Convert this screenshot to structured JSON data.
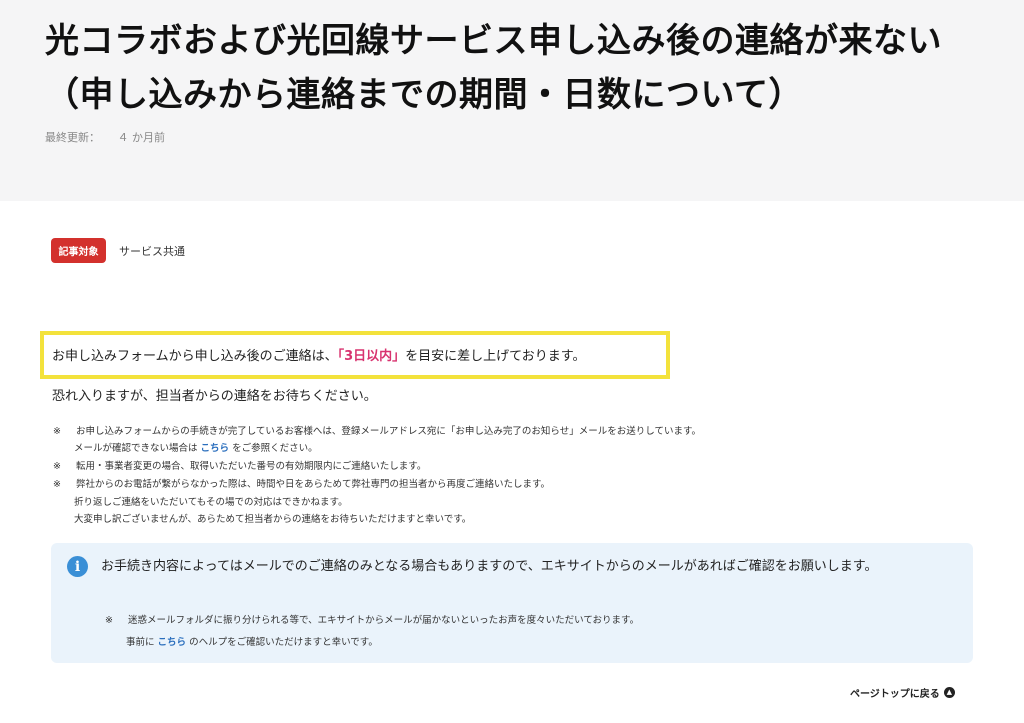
{
  "header": {
    "title": "光コラボおよび光回線サービス申し込み後の連絡が来ない（申し込みから連絡までの期間・日数について）",
    "updated_label": "最終更新：",
    "updated_value": "４ か月前"
  },
  "target": {
    "badge": "記事対象",
    "text": "サービス共通"
  },
  "lead": {
    "before": "お申し込みフォームから申し込み後のご連絡は、",
    "strong": "「3日以内」",
    "after": "を目安に差し上げております。",
    "line2": "恐れ入りますが、担当者からの連絡をお待ちください。"
  },
  "notes": {
    "mark": "※",
    "n1_line1": "お申し込みフォームからの手続きが完了しているお客様へは、登録メールアドレス宛に「お申し込み完了のお知らせ」メールをお送りしています。",
    "n1_line2_before": "メールが確認できない場合は",
    "n1_link": "こちら",
    "n1_line2_after": "をご参照ください。",
    "n2": "転用・事業者変更の場合、取得いただいた番号の有効期限内にご連絡いたします。",
    "n3_line1": "弊社からのお電話が繋がらなかった際は、時間や日をあらためて弊社専門の担当者から再度ご連絡いたします。",
    "n3_line2": "折り返しご連絡をいただいてもその場での対応はできかねます。",
    "n3_line3": "大変申し訳ございませんが、あらためて担当者からの連絡をお待ちいただけますと幸いです。"
  },
  "info": {
    "icon": "info-icon",
    "main": "お手続き内容によってはメールでのご連絡のみとなる場合もありますので、エキサイトからのメールがあればご確認をお願いします。",
    "mark": "※",
    "note_line1": "迷惑メールフォルダに振り分けられる等で、エキサイトからメールが届かないといったお声を度々いただいております。",
    "note_line2_before": "事前に",
    "note_link": "こちら",
    "note_line2_after": "のヘルプをご確認いただけますと幸いです。"
  },
  "footer": {
    "pagetop_label": "ページトップに戻る",
    "pagetop_icon": "chevron-up-icon"
  },
  "colors": {
    "badge": "#d3312d",
    "highlight_border": "#f3e23b",
    "emphasis": "#d8336f",
    "link": "#2a6ebd",
    "info_bg": "#eaf3fb",
    "info_icon": "#3a8fd6"
  }
}
